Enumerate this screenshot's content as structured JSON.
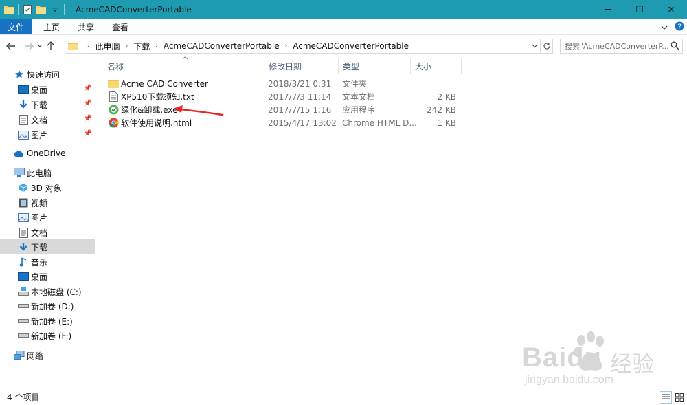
{
  "window": {
    "title": "AcmeCADConverterPortable",
    "controls": {
      "minimize": "─",
      "maximize": "☐",
      "close": "✕"
    }
  },
  "ribbon": {
    "tabs": [
      {
        "label": "文件"
      },
      {
        "label": "主页"
      },
      {
        "label": "共享"
      },
      {
        "label": "查看"
      }
    ]
  },
  "address": {
    "path": [
      "此电脑",
      "下载",
      "AcmeCADConverterPortable",
      "AcmeCADConverterPortable"
    ],
    "search_placeholder": "搜索\"AcmeCADConverterP..."
  },
  "sidebar": {
    "quick_access": "快速访问",
    "quick_items": [
      {
        "label": "桌面",
        "icon": "desktop-icon"
      },
      {
        "label": "下载",
        "icon": "download-icon"
      },
      {
        "label": "文档",
        "icon": "document-icon"
      },
      {
        "label": "图片",
        "icon": "picture-icon"
      }
    ],
    "onedrive": "OneDrive",
    "this_pc": "此电脑",
    "pc_items": [
      {
        "label": "3D 对象",
        "icon": "cube-icon"
      },
      {
        "label": "视频",
        "icon": "video-icon"
      },
      {
        "label": "图片",
        "icon": "picture-icon"
      },
      {
        "label": "文档",
        "icon": "document-icon"
      },
      {
        "label": "下载",
        "icon": "download-icon"
      },
      {
        "label": "音乐",
        "icon": "music-icon"
      },
      {
        "label": "桌面",
        "icon": "desktop-icon"
      },
      {
        "label": "本地磁盘 (C:)",
        "icon": "drive-icon"
      },
      {
        "label": "新加卷 (D:)",
        "icon": "drive-icon"
      },
      {
        "label": "新加卷 (E:)",
        "icon": "drive-icon"
      },
      {
        "label": "新加卷 (F:)",
        "icon": "drive-icon"
      }
    ],
    "network": "网络"
  },
  "columns": {
    "name": "名称",
    "date": "修改日期",
    "type": "类型",
    "size": "大小"
  },
  "files": [
    {
      "name": "Acme CAD Converter",
      "date": "2018/3/21 0:31",
      "type": "文件夹",
      "size": "",
      "icon": "folder-icon"
    },
    {
      "name": "XP510下载须知.txt",
      "date": "2017/7/3 11:14",
      "type": "文本文档",
      "size": "2 KB",
      "icon": "text-file-icon"
    },
    {
      "name": "绿化&卸载.exe",
      "date": "2017/7/15 1:16",
      "type": "应用程序",
      "size": "242 KB",
      "icon": "exe-icon"
    },
    {
      "name": "软件使用说明.html",
      "date": "2015/4/17 13:02",
      "type": "Chrome HTML D...",
      "size": "1 KB",
      "icon": "chrome-icon"
    }
  ],
  "status": {
    "item_count": "4 个项目"
  },
  "watermark": {
    "brand": "Baidu",
    "sub": "经验",
    "url": "jingyan.baidu.com"
  },
  "colors": {
    "titlebar": "#1e9bb0",
    "file_tab": "#1a73c2",
    "accent_blue": "#1a73c2",
    "selected_row": "#d9d9d9",
    "arrow": "#e8262a"
  }
}
